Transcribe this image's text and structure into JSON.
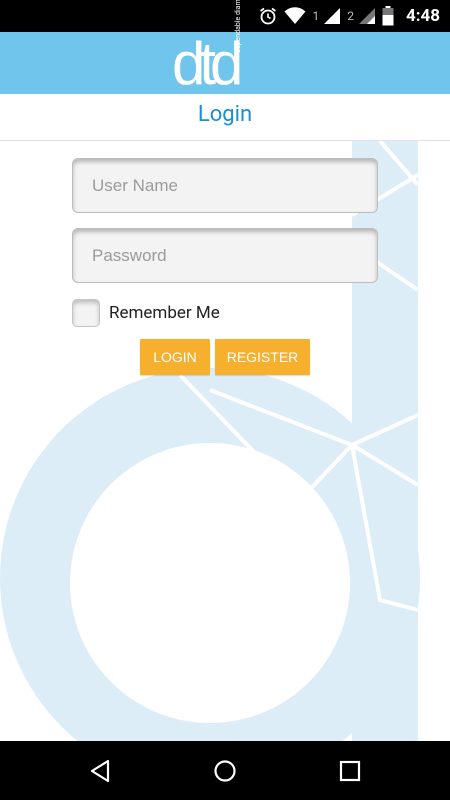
{
  "status_bar": {
    "sim1": "1",
    "sim2": "2",
    "time": "4:48",
    "icons": [
      "alarm-icon",
      "wifi-icon",
      "signal-icon",
      "signal-icon",
      "battery-icon"
    ]
  },
  "header": {
    "logo_text": "dtd",
    "logo_subtext": "dependable diamonds"
  },
  "page": {
    "title": "Login"
  },
  "form": {
    "username_placeholder": "User Name",
    "username_value": "",
    "password_placeholder": "Password",
    "password_value": "",
    "remember_label": "Remember Me",
    "remember_checked": false,
    "login_label": "LOGIN",
    "register_label": "REGISTER"
  },
  "nav": {
    "icons": [
      "back-icon",
      "home-icon",
      "recents-icon"
    ]
  },
  "colors": {
    "header_bg": "#70c5ec",
    "title_color": "#1b8fd0",
    "button_bg": "#f7b02e",
    "art_color": "#dcedf8"
  }
}
